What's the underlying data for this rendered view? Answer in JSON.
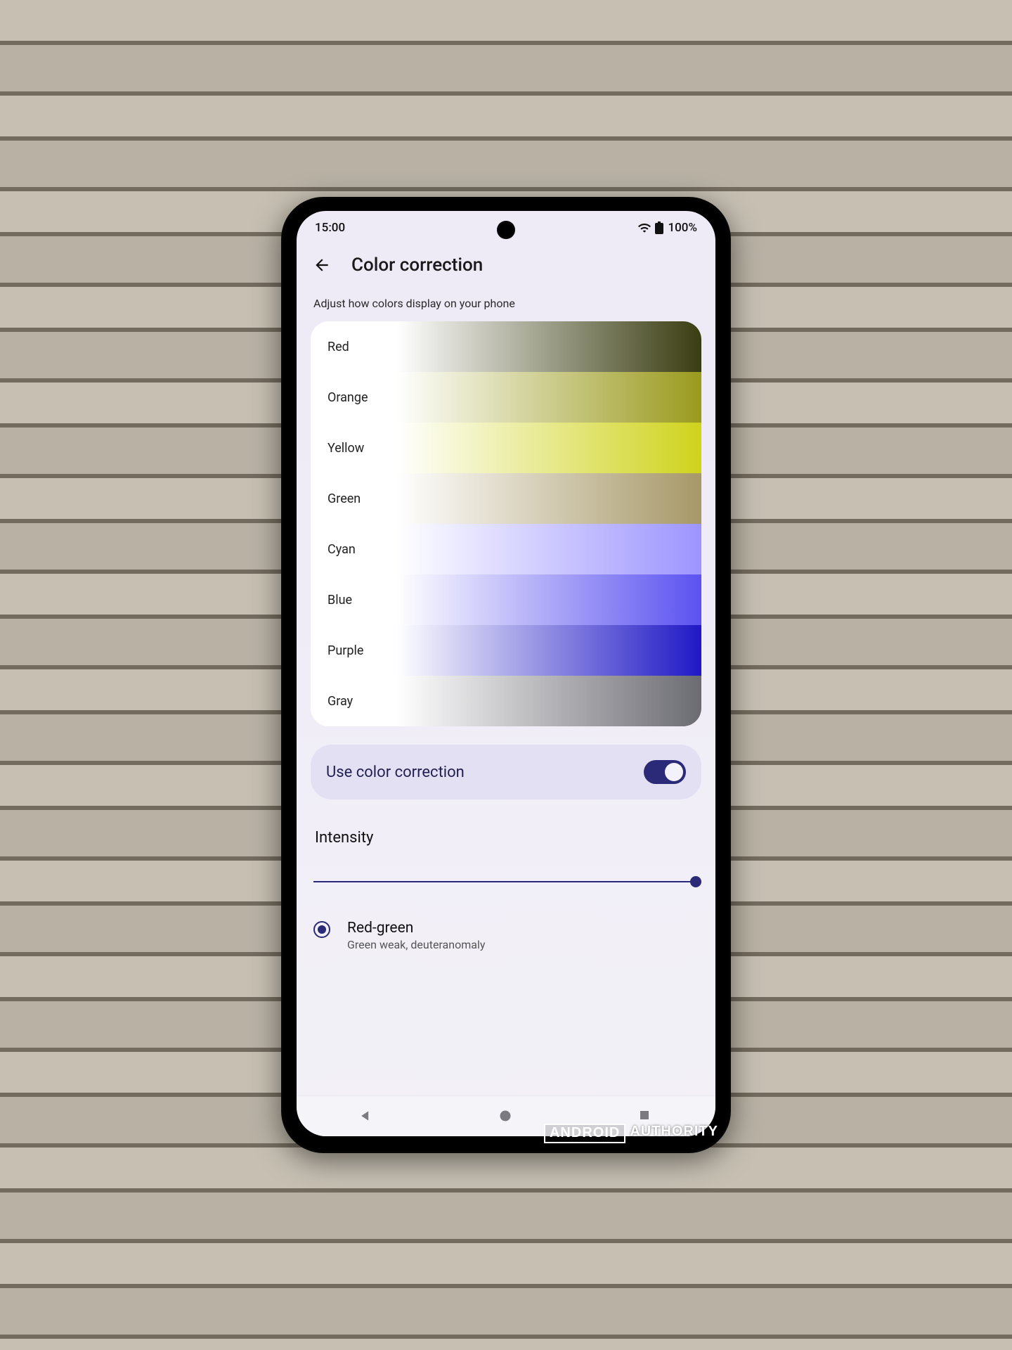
{
  "statusbar": {
    "time": "15:00",
    "battery": "100%"
  },
  "header": {
    "title": "Color correction"
  },
  "subtitle": "Adjust how colors display on your phone",
  "preview_colors": [
    {
      "label": "Red",
      "end": "#3a3d12"
    },
    {
      "label": "Orange",
      "end": "#9a9a1e"
    },
    {
      "label": "Yellow",
      "end": "#cfd31c"
    },
    {
      "label": "Green",
      "end": "#a79868"
    },
    {
      "label": "Cyan",
      "end": "#9d95ff"
    },
    {
      "label": "Blue",
      "end": "#5b52f0"
    },
    {
      "label": "Purple",
      "end": "#1f18c5"
    },
    {
      "label": "Gray",
      "end": "#6b6b72"
    }
  ],
  "toggle": {
    "label": "Use color correction",
    "on": true
  },
  "intensity": {
    "label": "Intensity",
    "value_percent": 100
  },
  "option": {
    "selected": true,
    "title": "Red-green",
    "subtitle": "Green weak, deuteranomaly"
  },
  "watermark": {
    "brand": "ANDROID",
    "suffix": "AUTHORITY"
  }
}
